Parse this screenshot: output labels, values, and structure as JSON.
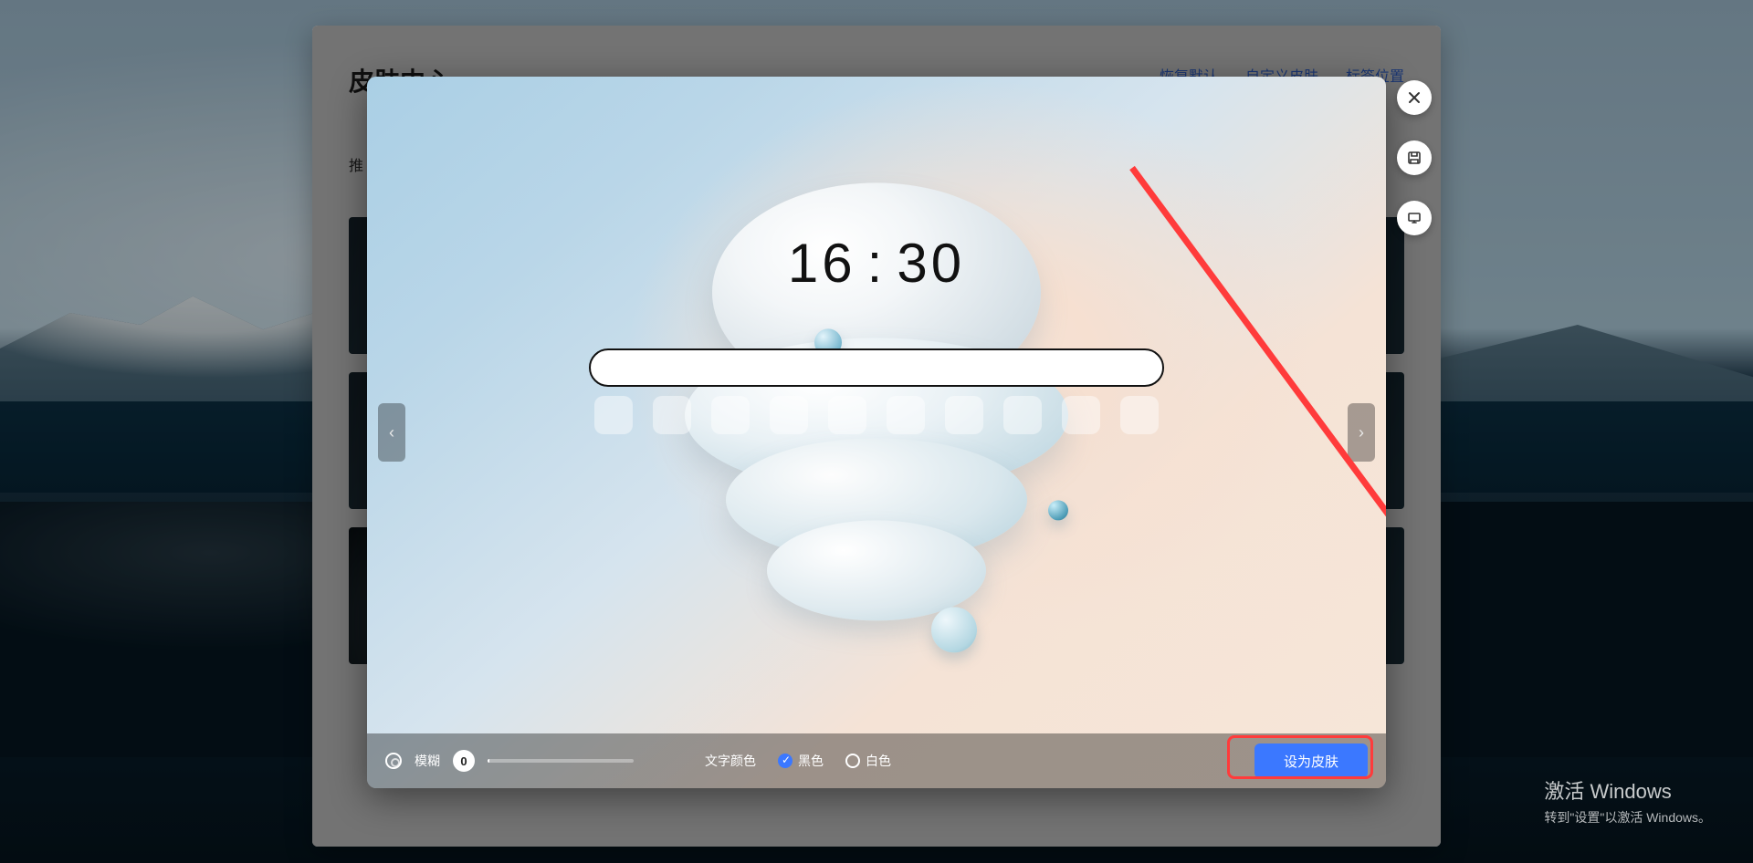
{
  "panel": {
    "title": "皮肤中心",
    "subtitle_prefix": "推",
    "links": {
      "restore": "恢复默认",
      "custom": "自定义皮肤",
      "tabpos": "标签位置"
    }
  },
  "modal": {
    "clock": {
      "hh": "16",
      "sep": ":",
      "mm": "30"
    },
    "nav": {
      "prev": "‹",
      "next": "›"
    },
    "bar": {
      "blur_label": "模糊",
      "blur_value": "0",
      "textcolor_label": "文字颜色",
      "opt_black": "黑色",
      "opt_white": "白色",
      "selected": "black",
      "apply": "设为皮肤"
    }
  },
  "fab": {
    "close": "close-icon",
    "save": "save-icon",
    "desktop": "desktop-icon"
  },
  "watermark": {
    "line1": "激活 Windows",
    "line2": "转到\"设置\"以激活 Windows。"
  },
  "annotation": {
    "arrow_color": "#ff3b3b",
    "highlight_target": "apply-skin-button"
  }
}
